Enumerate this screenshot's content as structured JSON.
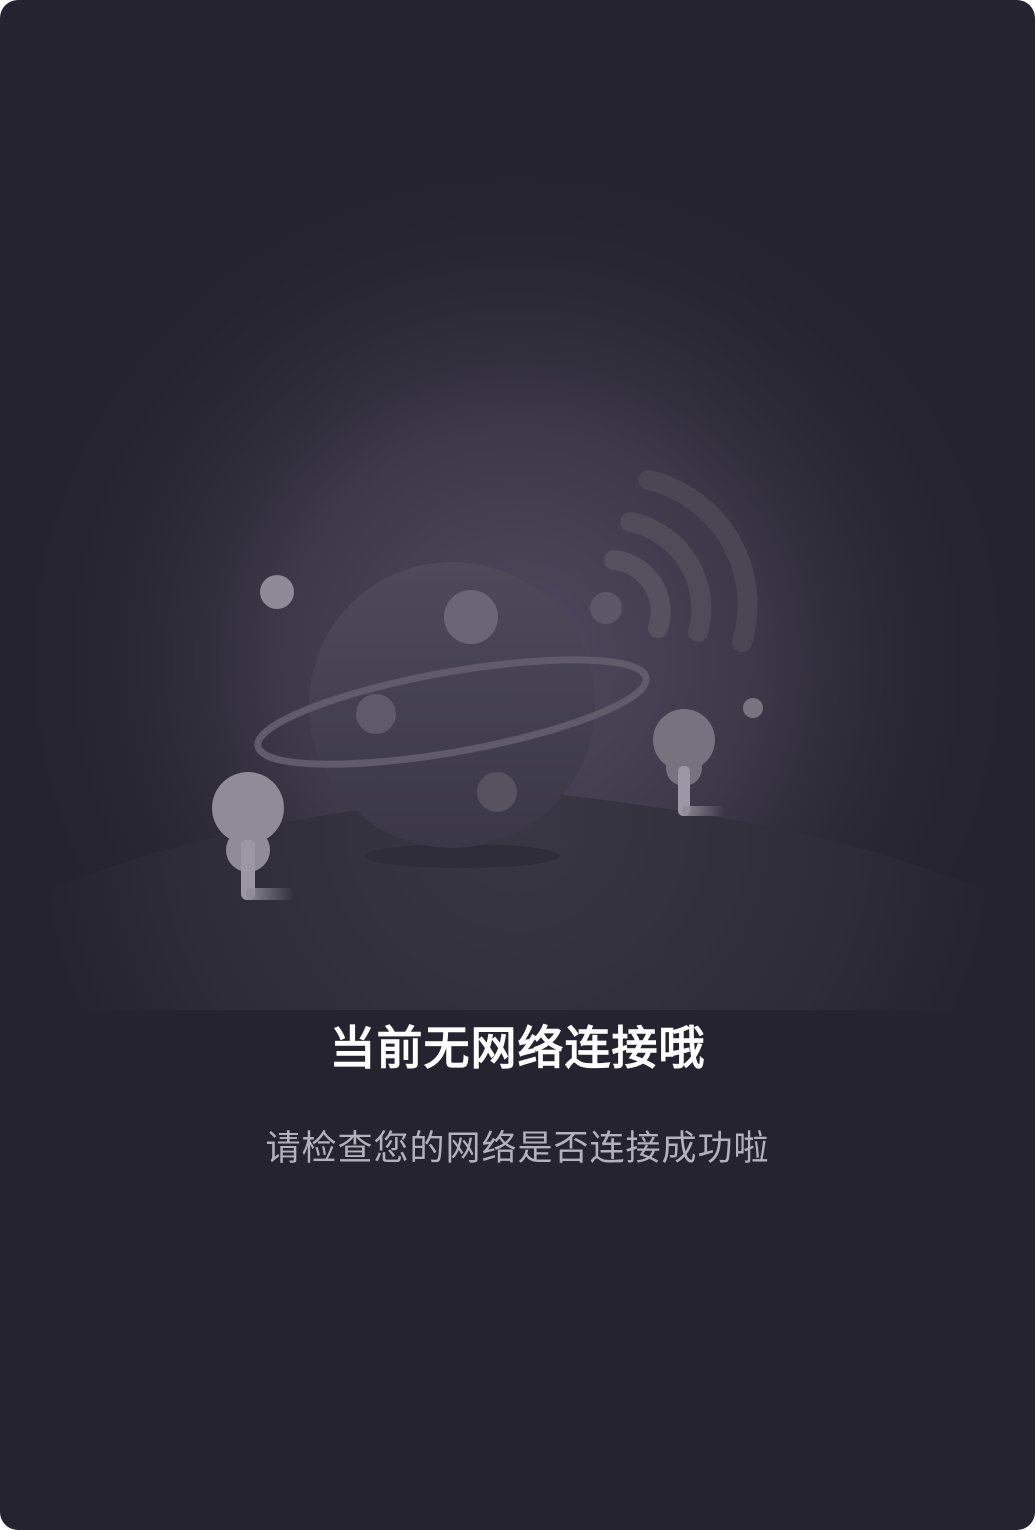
{
  "empty_state": {
    "title": "当前无网络连接哦",
    "message": "请检查您的网络是否连接成功啦",
    "illustration": {
      "icons": [
        "planet-icon",
        "wifi-signal-icon",
        "tree-icon"
      ]
    }
  },
  "colors": {
    "background": "#25232f",
    "glow": "#4a4558",
    "title": "#ffffff",
    "message": "#b3b1bb"
  }
}
